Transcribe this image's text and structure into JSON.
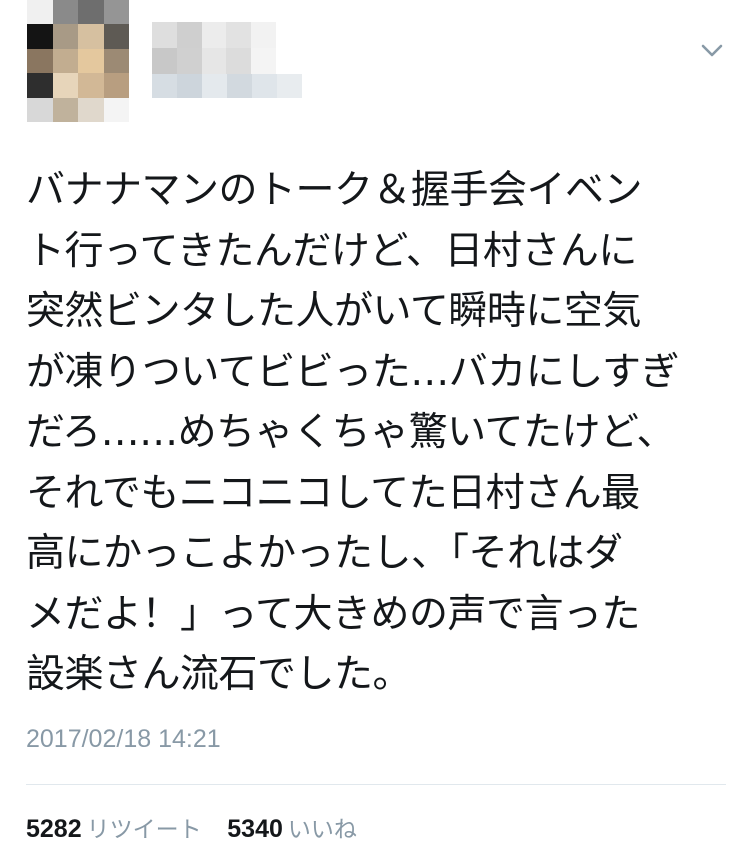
{
  "author": {
    "avatar_pixels": [
      "#f0f0f0",
      "#8a8a8a",
      "#6e6e6e",
      "#959595",
      "#141414",
      "#a89a86",
      "#d6c0a0",
      "#5e5a54",
      "#8a7660",
      "#c2ad90",
      "#e4c89e",
      "#9c8a74",
      "#2e2e2e",
      "#e7d5ba",
      "#d2b896",
      "#b89e80",
      "#d8d8d8",
      "#c0b29c",
      "#e0d8cc",
      "#f4f4f4"
    ],
    "name_pixels": [
      "#dedede",
      "#cfcfcf",
      "#ececec",
      "#e2e2e2",
      "#f2f2f2",
      "#c8c8c8",
      "#d0d0d0",
      "#e6e6e6",
      "#dcdcdc",
      "#f4f4f4"
    ],
    "handle_pixels": [
      "#d6dde3",
      "#cdd5dc",
      "#e4e9ed",
      "#d2d9df",
      "#dfe5ea",
      "#e8ecef"
    ]
  },
  "colors": {
    "text": "#14171a",
    "muted": "#8899a6",
    "divider": "#e1e8ed"
  },
  "tweet": {
    "lines": [
      "バナナマンのトーク＆握手会イベン",
      "ト行ってきたんだけど、日村さんに",
      "突然ビンタした人がいて瞬時に空気",
      "が凍りついてビビった…バカにしすぎ",
      "だろ……めちゃくちゃ驚いてたけど、",
      "それでもニコニコしてた日村さん最",
      "高にかっこよかったし、「それはダ",
      "メだよ！」って大きめの声で言った",
      "設楽さん流石でした。"
    ],
    "timestamp": "2017/02/18 14:21"
  },
  "stats": {
    "retweets": {
      "count": "5282",
      "label": "リツイート"
    },
    "likes": {
      "count": "5340",
      "label": "いいね"
    }
  },
  "icons": {
    "menu": "chevron-down-icon"
  }
}
